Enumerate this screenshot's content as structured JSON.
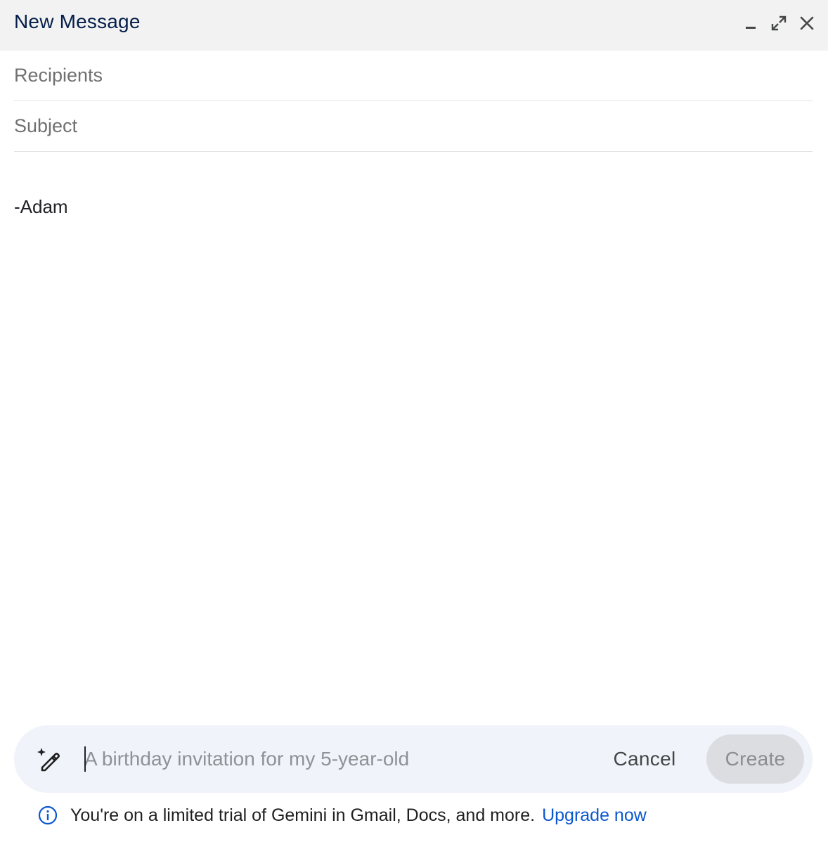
{
  "window": {
    "title": "New Message",
    "controls": {
      "minimize_icon": "minimize-icon",
      "expand_icon": "expand-icon",
      "close_icon": "close-icon"
    }
  },
  "compose": {
    "recipients_placeholder": "Recipients",
    "subject_placeholder": "Subject",
    "body_signature": "-Adam"
  },
  "gemini": {
    "wand_icon": "magic-pen-icon",
    "prompt_placeholder": "A birthday invitation for my 5-year-old",
    "cancel_label": "Cancel",
    "create_label": "Create",
    "notice_text": "You're on a limited trial of Gemini in Gmail, Docs, and more.",
    "upgrade_label": "Upgrade now",
    "info_icon": "info-icon"
  },
  "colors": {
    "title": "#041e49",
    "titlebar_bg": "#f2f2f2",
    "gemini_bar_bg": "#f1f3fb",
    "link": "#0b57d0",
    "create_disabled_bg": "#dcdde1"
  }
}
